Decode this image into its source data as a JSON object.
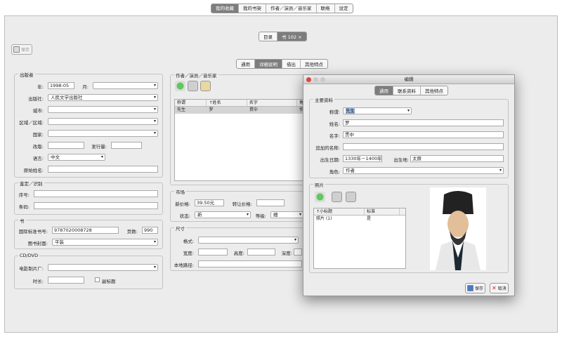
{
  "top_tabs": [
    "我的收藏",
    "我的书架",
    "作者／演员／音乐家",
    "联络",
    "设定"
  ],
  "doc_tabs": {
    "list": "目录",
    "book": "书 102",
    "close": "×"
  },
  "save_label": "保存",
  "sub_tabs": [
    "通用",
    "详细说明",
    "借出",
    "其他特点"
  ],
  "publisher": {
    "title": "出版者",
    "year_label": "年:",
    "year": "1998-05",
    "month_label": "月:",
    "press_label": "出版社:",
    "press": "人民文学出版社",
    "city_label": "城市:",
    "region_label": "区域／区域:",
    "country_label": "国家:",
    "edition_label": "改版:",
    "printrun_label": "发行量:",
    "lang_label": "语言:",
    "lang": "中文",
    "orig_title_label": "原始姓名:"
  },
  "ident": {
    "title": "鉴定／识别",
    "serial_label": "序号:",
    "barcode_label": "条码:"
  },
  "book": {
    "title": "书",
    "isbn_label": "国际标准书号:",
    "isbn": "9787020008728",
    "pages_label": "页数:",
    "pages": "990",
    "cover_label": "图书封面:",
    "cover": "平装"
  },
  "cd": {
    "title": "CD/DVD",
    "maker_label": "电影制片厂:",
    "length_label": "时长:",
    "subtitle_label": "副标题"
  },
  "authors": {
    "title": "作者／演员／音乐家",
    "cols": [
      "称谓",
      "↑姓名",
      "名字",
      "角"
    ],
    "rows": [
      [
        "先生",
        "罗",
        "贯中",
        "作"
      ]
    ]
  },
  "market": {
    "title": "市场",
    "price_label": "新价格:",
    "price": "39.50元",
    "resale_label": "转让价格:",
    "state_label": "状态:",
    "state": "新",
    "grade_label": "等级:",
    "grade": "细"
  },
  "size": {
    "title": "尺寸",
    "format_label": "格式:",
    "width_label": "宽度:",
    "height_label": "高度:",
    "depth_label": "深度:",
    "path_label": "本地路径:"
  },
  "dialog": {
    "title": "编辑",
    "tabs": [
      "通用",
      "联系资料",
      "其他特点"
    ],
    "main_title": "主要资料",
    "salutation_label": "称谓:",
    "salutation": "先生",
    "surname_label": "姓名:",
    "surname": "罗",
    "given_label": "名字:",
    "given": "贯中",
    "extra_label": "追加的名称:",
    "birth_label": "出生日期:",
    "birth": "1330年－1400年",
    "birthplace_label": "出生地:",
    "birthplace": "太原",
    "role_label": "角色:",
    "role": "作者",
    "photo_title": "照片",
    "photo_cols": [
      "↑小标题",
      "标准"
    ],
    "photo_rows": [
      [
        "照片 (1)",
        "是"
      ]
    ],
    "save_label": "保存",
    "cancel_label": "取消"
  }
}
